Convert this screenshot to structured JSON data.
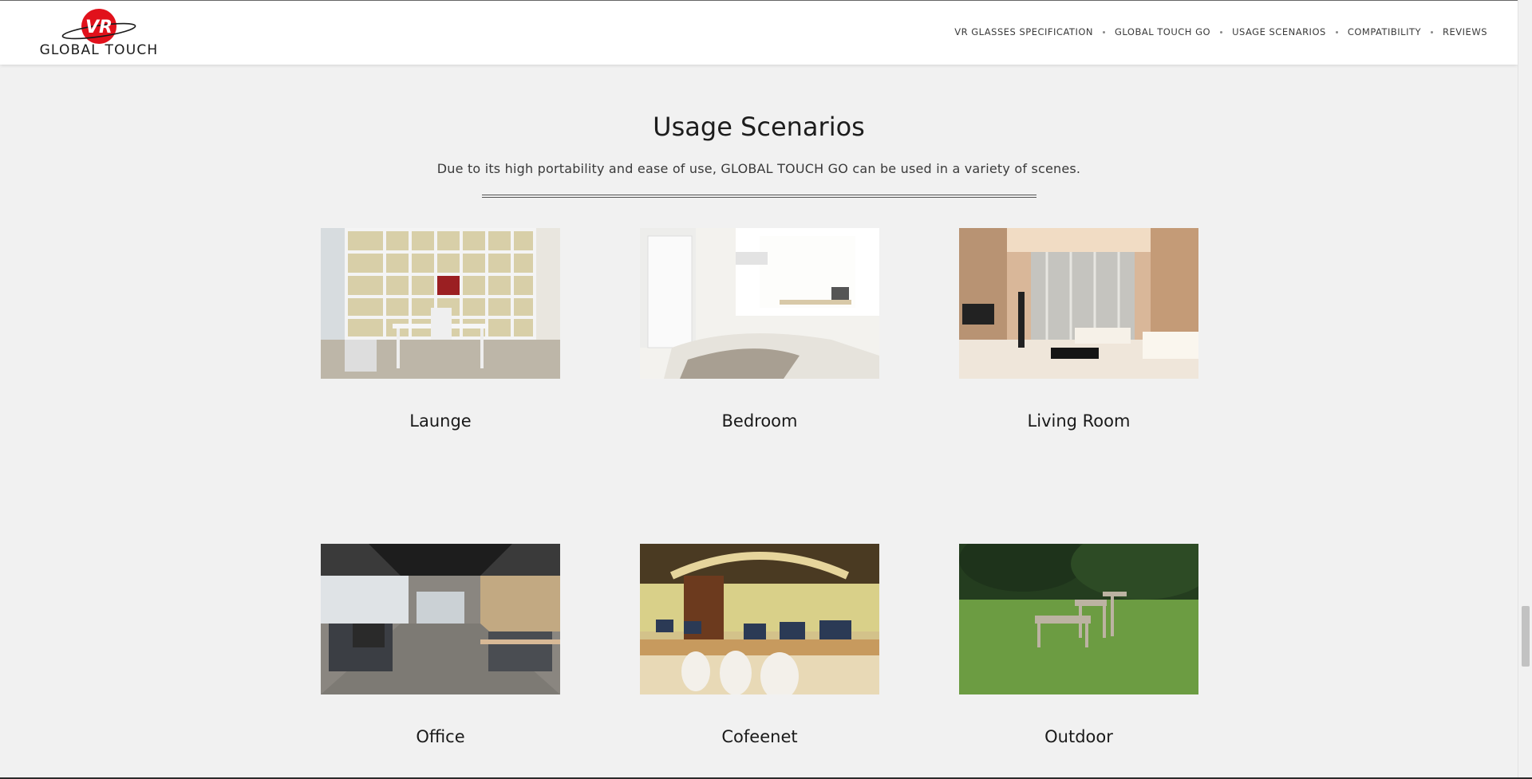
{
  "header": {
    "logo": {
      "text": "GLOBAL TOUCH",
      "badge": "VR",
      "accent": "#e1111b"
    },
    "nav": [
      {
        "label": "VR GLASSES SPECIFICATION"
      },
      {
        "label": "GLOBAL TOUCH GO"
      },
      {
        "label": "USAGE SCENARIOS"
      },
      {
        "label": "COMPATIBILITY"
      },
      {
        "label": "REVIEWS"
      }
    ]
  },
  "section": {
    "title": "Usage Scenarios",
    "subtitle": "Due to its high portability and ease of use, GLOBAL TOUCH GO can be used in a variety of scenes."
  },
  "scenarios": [
    {
      "label": "Launge",
      "image": "study-room-photo"
    },
    {
      "label": "Bedroom",
      "image": "bedroom-photo"
    },
    {
      "label": "Living Room",
      "image": "living-room-photo"
    },
    {
      "label": "Office",
      "image": "office-photo"
    },
    {
      "label": "Cofeenet",
      "image": "internet-cafe-photo"
    },
    {
      "label": "Outdoor",
      "image": "lawn-chairs-photo"
    }
  ]
}
